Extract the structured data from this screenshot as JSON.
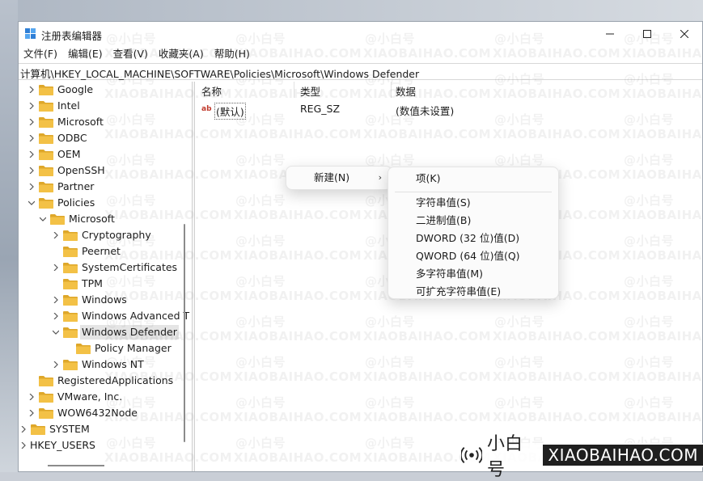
{
  "window": {
    "title": "注册表编辑器"
  },
  "menu": [
    "文件(F)",
    "编辑(E)",
    "查看(V)",
    "收藏夹(A)",
    "帮助(H)"
  ],
  "address": "计算机\\HKEY_LOCAL_MACHINE\\SOFTWARE\\Policies\\Microsoft\\Windows Defender",
  "tree": [
    {
      "label": "Google",
      "chevron": "right",
      "level": 1
    },
    {
      "label": "Intel",
      "chevron": "right",
      "level": 1
    },
    {
      "label": "Microsoft",
      "chevron": "right",
      "level": 1
    },
    {
      "label": "ODBC",
      "chevron": "right",
      "level": 1
    },
    {
      "label": "OEM",
      "chevron": "right",
      "level": 1
    },
    {
      "label": "OpenSSH",
      "chevron": "right",
      "level": 1
    },
    {
      "label": "Partner",
      "chevron": "right",
      "level": 1
    },
    {
      "label": "Policies",
      "chevron": "down",
      "level": 1
    },
    {
      "label": "Microsoft",
      "chevron": "down",
      "level": 2
    },
    {
      "label": "Cryptography",
      "chevron": "right",
      "level": 3
    },
    {
      "label": "Peernet",
      "chevron": "none",
      "level": 3
    },
    {
      "label": "SystemCertificates",
      "chevron": "right",
      "level": 3
    },
    {
      "label": "TPM",
      "chevron": "none",
      "level": 3
    },
    {
      "label": "Windows",
      "chevron": "right",
      "level": 3
    },
    {
      "label": "Windows Advanced T",
      "chevron": "right",
      "level": 3
    },
    {
      "label": "Windows Defender",
      "chevron": "down",
      "level": 3,
      "selected": true
    },
    {
      "label": "Policy Manager",
      "chevron": "none",
      "level": 4
    },
    {
      "label": "Windows NT",
      "chevron": "right",
      "level": 3
    },
    {
      "label": "RegisteredApplications",
      "chevron": "none",
      "level": 1
    },
    {
      "label": "VMware, Inc.",
      "chevron": "right",
      "level": 1
    },
    {
      "label": "WOW6432Node",
      "chevron": "right",
      "level": 1
    },
    {
      "label": "SYSTEM",
      "chevron": "right",
      "level": 0
    },
    {
      "label": "HKEY_USERS",
      "chevron": "right",
      "level": -1
    }
  ],
  "list": {
    "headers": {
      "name": "名称",
      "type": "类型",
      "data": "数据"
    },
    "rows": [
      {
        "name": "(默认)",
        "type": "REG_SZ",
        "data": "(数值未设置)"
      }
    ]
  },
  "context_menu": {
    "new_label": "新建(N)"
  },
  "submenu": {
    "key": "项(K)",
    "items": [
      "字符串值(S)",
      "二进制值(B)",
      "DWORD (32 位)值(D)",
      "QWORD (64 位)值(Q)",
      "多字符串值(M)",
      "可扩充字符串值(E)"
    ]
  },
  "watermark": {
    "brand_cn": "小白号",
    "brand_en": "XIAOBAIHAO.COM",
    "wm_cn": "@小白号",
    "wm_en": "XIAOBAIHAO.COM"
  },
  "colors": {
    "folder": "#f3c146",
    "folder_dark": "#dea72a",
    "selection": "#e5e5e5"
  }
}
